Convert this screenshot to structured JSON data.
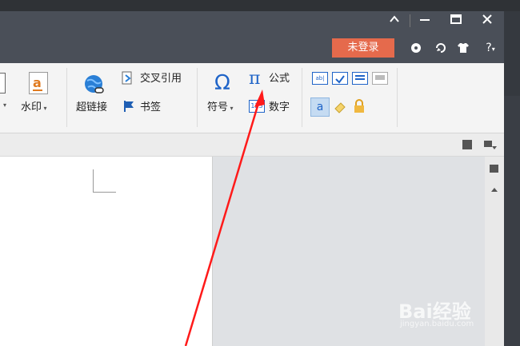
{
  "window": {
    "collapse_icon": "chevron-up-icon",
    "minimize_icon": "minimize-icon",
    "maximize_icon": "maximize-icon",
    "close_icon": "close-icon"
  },
  "account": {
    "login_label": "未登录",
    "help_label": "?"
  },
  "ribbon": {
    "watermark_label": "水印",
    "hyperlink_label": "超链接",
    "crossref_label": "交叉引用",
    "bookmark_label": "书签",
    "symbol_label": "符号",
    "formula_label": "公式",
    "number_label": "数字",
    "symbol_glyph": "Ω",
    "formula_glyph": "π"
  },
  "watermark": {
    "brand": "Bai经验",
    "url": "jingyan.baidu.com"
  },
  "colors": {
    "titlebar": "#4a4f58",
    "login_button": "#e56a4c",
    "arrow": "#ff1a1a"
  }
}
